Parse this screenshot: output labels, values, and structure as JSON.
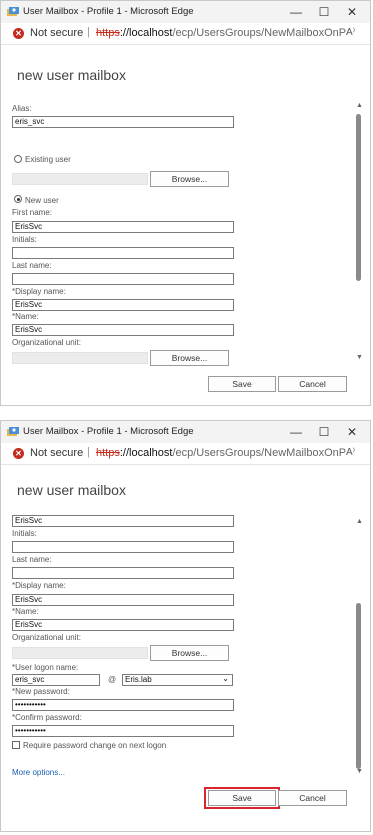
{
  "window1": {
    "title": "User Mailbox - Profile 1 - Microsoft Edge",
    "controls": {
      "minimize": "—",
      "maximize": "☐",
      "close": "✕"
    },
    "address": {
      "not_secure": "Not secure",
      "separator": "|",
      "https": "https",
      "host": "://localhost",
      "path": "/ecp/UsersGroups/NewMailboxOnPremises...",
      "read_aloud": "A⁾"
    },
    "heading": "new user mailbox",
    "alias_label": "Alias:",
    "alias_value": "eris_svc",
    "existing_user_label": "Existing user",
    "browse_label": "Browse...",
    "new_user_label": "New user",
    "first_name_label": "First name:",
    "first_name_value": "ErisSvc",
    "initials_label": "Initials:",
    "initials_value": "",
    "last_name_label": "Last name:",
    "last_name_value": "",
    "display_name_label": "*Display name:",
    "display_name_value": "ErisSvc",
    "name_label": "*Name:",
    "name_value": "ErisSvc",
    "ou_label": "Organizational unit:",
    "ou_browse_label": "Browse...",
    "save_label": "Save",
    "cancel_label": "Cancel"
  },
  "window2": {
    "title": "User Mailbox - Profile 1 - Microsoft Edge",
    "controls": {
      "minimize": "—",
      "maximize": "☐",
      "close": "✕"
    },
    "address": {
      "not_secure": "Not secure",
      "separator": "|",
      "https": "https",
      "host": "://localhost",
      "path": "/ecp/UsersGroups/NewMailboxOnPremises...",
      "read_aloud": "A⁾"
    },
    "heading": "new user mailbox",
    "top_value": "ErisSvc",
    "initials_label": "Initials:",
    "last_name_label": "Last name:",
    "display_name_label": "*Display name:",
    "display_name_value": "ErisSvc",
    "name_label": "*Name:",
    "name_value": "ErisSvc",
    "ou_label": "Organizational unit:",
    "ou_browse_label": "Browse...",
    "logon_label": "*User logon name:",
    "logon_value": "eris_svc",
    "at_sign": "@",
    "domain_value": "Eris.lab",
    "new_password_label": "*New password:",
    "new_password_value": "•••••••••••",
    "confirm_password_label": "*Confirm password:",
    "confirm_password_value": "•••••••••••",
    "require_change_label": "Require password change on next logon",
    "more_options_label": "More options...",
    "save_label": "Save",
    "cancel_label": "Cancel"
  }
}
